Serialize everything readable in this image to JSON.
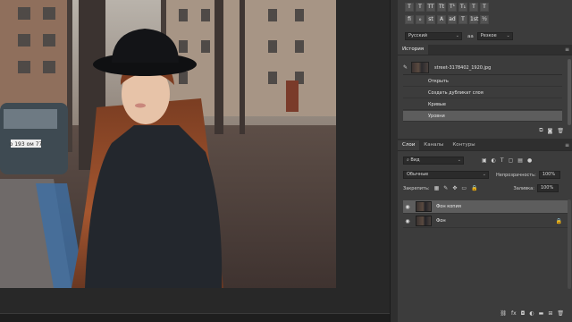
{
  "document": {
    "car_plate": "о 193 ом 77"
  },
  "character_panel": {
    "glyph_buttons": [
      "ﬁ",
      "ℴ",
      "st",
      "A",
      "ad",
      "T",
      "1st",
      "½"
    ],
    "language": "Русский",
    "antialias": "Резкое",
    "aa_icon": "aa"
  },
  "history_panel": {
    "tab_label": "История",
    "snapshot_name": "street-3178402_1920.jpg",
    "items": [
      "Открыть",
      "Создать дубликат слоя",
      "Кривые",
      "Уровни"
    ],
    "selected_index": 3
  },
  "layers_panel": {
    "tabs": [
      "Слои",
      "Каналы",
      "Контуры"
    ],
    "filter_kind": "Вид",
    "blend_mode": "Обычные",
    "opacity_label": "Непрозрачность:",
    "opacity_value": "100%",
    "lock_label": "Закрепить:",
    "fill_label": "Заливка:",
    "fill_value": "100%",
    "layers": [
      {
        "name": "Фон копия",
        "selected": true
      },
      {
        "name": "Фон",
        "selected": false,
        "locked": true
      }
    ],
    "footer_icons": [
      "link-icon",
      "fx-icon",
      "mask-icon",
      "adjustment-icon",
      "group-icon",
      "new-layer-icon",
      "trash-icon"
    ]
  },
  "colors": {
    "panel_bg": "#3c3c3c",
    "app_bg": "#282828",
    "selected_row": "#5d5d5d"
  }
}
